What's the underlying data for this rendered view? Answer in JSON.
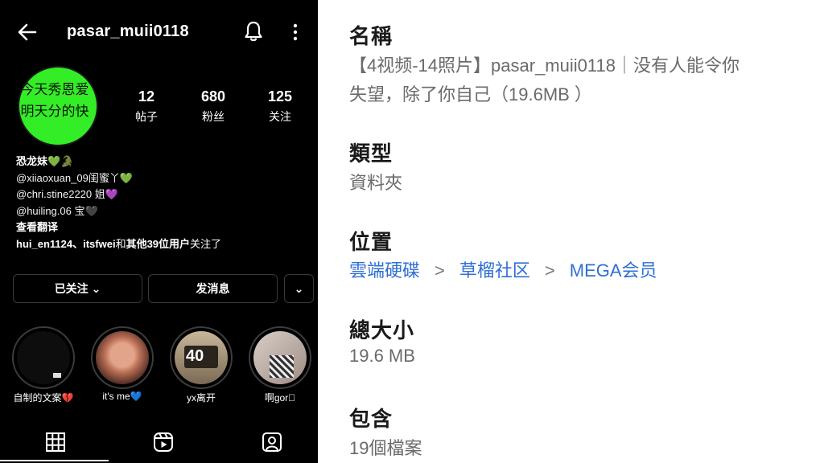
{
  "profile": {
    "username": "pasar_muii0118",
    "avatar_text": [
      "今天秀恩爱",
      "明天分的快"
    ],
    "stats": [
      {
        "value": "12",
        "label": "帖子"
      },
      {
        "value": "680",
        "label": "粉丝"
      },
      {
        "value": "125",
        "label": "关注"
      }
    ],
    "bio_name": "恐龙妹💚🐊",
    "bio_lines": [
      "@xiiaoxuan_09闺蜜丫💚",
      "@chri.stine2220 姐💜",
      "@huiling.06 宝🖤"
    ],
    "translate_link": "查看翻译",
    "followed_by_a": "hui_en1124、itsfwei",
    "followed_by_b": "和",
    "followed_by_c": "其他39位用户",
    "followed_by_d": "关注了",
    "buttons": {
      "following": "已关注 ⌄",
      "message": "发消息",
      "more": "⌄"
    },
    "highlights": [
      {
        "label": "自制的文案💔"
      },
      {
        "label": "it's me💙"
      },
      {
        "label": "yx离开",
        "badge": "40"
      },
      {
        "label": "啊gor\u0000"
      }
    ],
    "icons": {
      "back": "arrow-left",
      "bell": "bell",
      "more": "more-vertical",
      "grid": "grid",
      "reels": "reels",
      "tagged": "tagged-user"
    },
    "colors": {
      "background": "#000000",
      "avatar": "#33ee26",
      "border": "#3a3a3a"
    }
  },
  "properties": {
    "name_title": "名稱",
    "name_value_line1": "【4视频-14照片】pasar_muii0118｜没有人能令你",
    "name_value_line2": "失望，除了你自己（19.6MB ）",
    "type_title": "類型",
    "type_value": "資料夾",
    "location_title": "位置",
    "location_path": [
      "雲端硬碟",
      "草榴社区",
      "MEGA会员"
    ],
    "location_sep": ">",
    "size_title": "總大小",
    "size_value": "19.6 MB",
    "contains_title": "包含",
    "contains_value": "19個檔案",
    "colors": {
      "link": "#2f6fd6",
      "title": "#1a1a1a",
      "value": "#6a6a6a"
    }
  }
}
